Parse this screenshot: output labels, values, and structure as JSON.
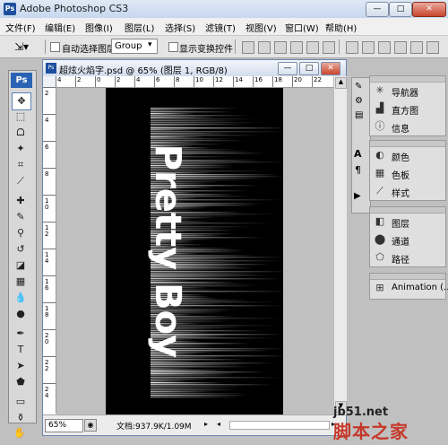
{
  "window": {
    "app_icon": "Ps",
    "title": "Adobe Photoshop CS3",
    "minimize": "—",
    "maximize": "□",
    "close": "✕"
  },
  "menubar": [
    "文件(F)",
    "编辑(E)",
    "图像(I)",
    "图层(L)",
    "选择(S)",
    "滤镜(T)",
    "视图(V)",
    "窗口(W)",
    "帮助(H)"
  ],
  "options_bar": {
    "move_tool_icon": "move-icon",
    "auto_select_label": "自动选择图层",
    "auto_select_value": "Group",
    "show_transform_label": "显示变换控件"
  },
  "toolbox": {
    "logo": "Ps",
    "tools": [
      "move-icon",
      "marquee-icon",
      "lasso-icon",
      "magic-wand-icon",
      "crop-icon",
      "slice-icon",
      "healing-icon",
      "brush-icon",
      "stamp-icon",
      "history-brush-icon",
      "eraser-icon",
      "gradient-icon",
      "blur-icon",
      "dodge-icon",
      "pen-icon",
      "type-icon",
      "path-select-icon",
      "shape-icon",
      "notes-icon",
      "eyedropper-icon",
      "hand-icon",
      "zoom-icon"
    ]
  },
  "document": {
    "icon": "Ps",
    "title": "超炫火焰字.psd @ 65% (图层 1, RGB/8)",
    "zoom": "65%",
    "info": "文档:937.9K/1.09M",
    "canvas_text": "Pretty Boy",
    "ruler_h_labels": [
      "4",
      "2",
      "0",
      "2",
      "4",
      "6",
      "8",
      "10",
      "12",
      "14",
      "16",
      "18",
      "20",
      "22"
    ],
    "ruler_v_labels": [
      "2",
      "4",
      "6",
      "8",
      "1\n0",
      "1\n2",
      "1\n4",
      "1\n6",
      "1\n8",
      "2\n0",
      "2\n2",
      "2\n4"
    ]
  },
  "panels": {
    "group1": [
      {
        "icon": "navigator-icon",
        "label": "导航器"
      },
      {
        "icon": "histogram-icon",
        "label": "直方图"
      },
      {
        "icon": "info-icon",
        "label": "信息"
      }
    ],
    "group2": [
      {
        "icon": "color-icon",
        "label": "颜色"
      },
      {
        "icon": "swatches-icon",
        "label": "色板"
      },
      {
        "icon": "styles-icon",
        "label": "样式"
      }
    ],
    "group3": [
      {
        "icon": "layers-icon",
        "label": "图层"
      },
      {
        "icon": "channels-icon",
        "label": "通道"
      },
      {
        "icon": "paths-icon",
        "label": "路径"
      }
    ],
    "group4": [
      {
        "icon": "animation-icon",
        "label": "Animation (..."
      }
    ]
  },
  "watermark": {
    "url": "jb51.net",
    "name": "脚本之家"
  }
}
